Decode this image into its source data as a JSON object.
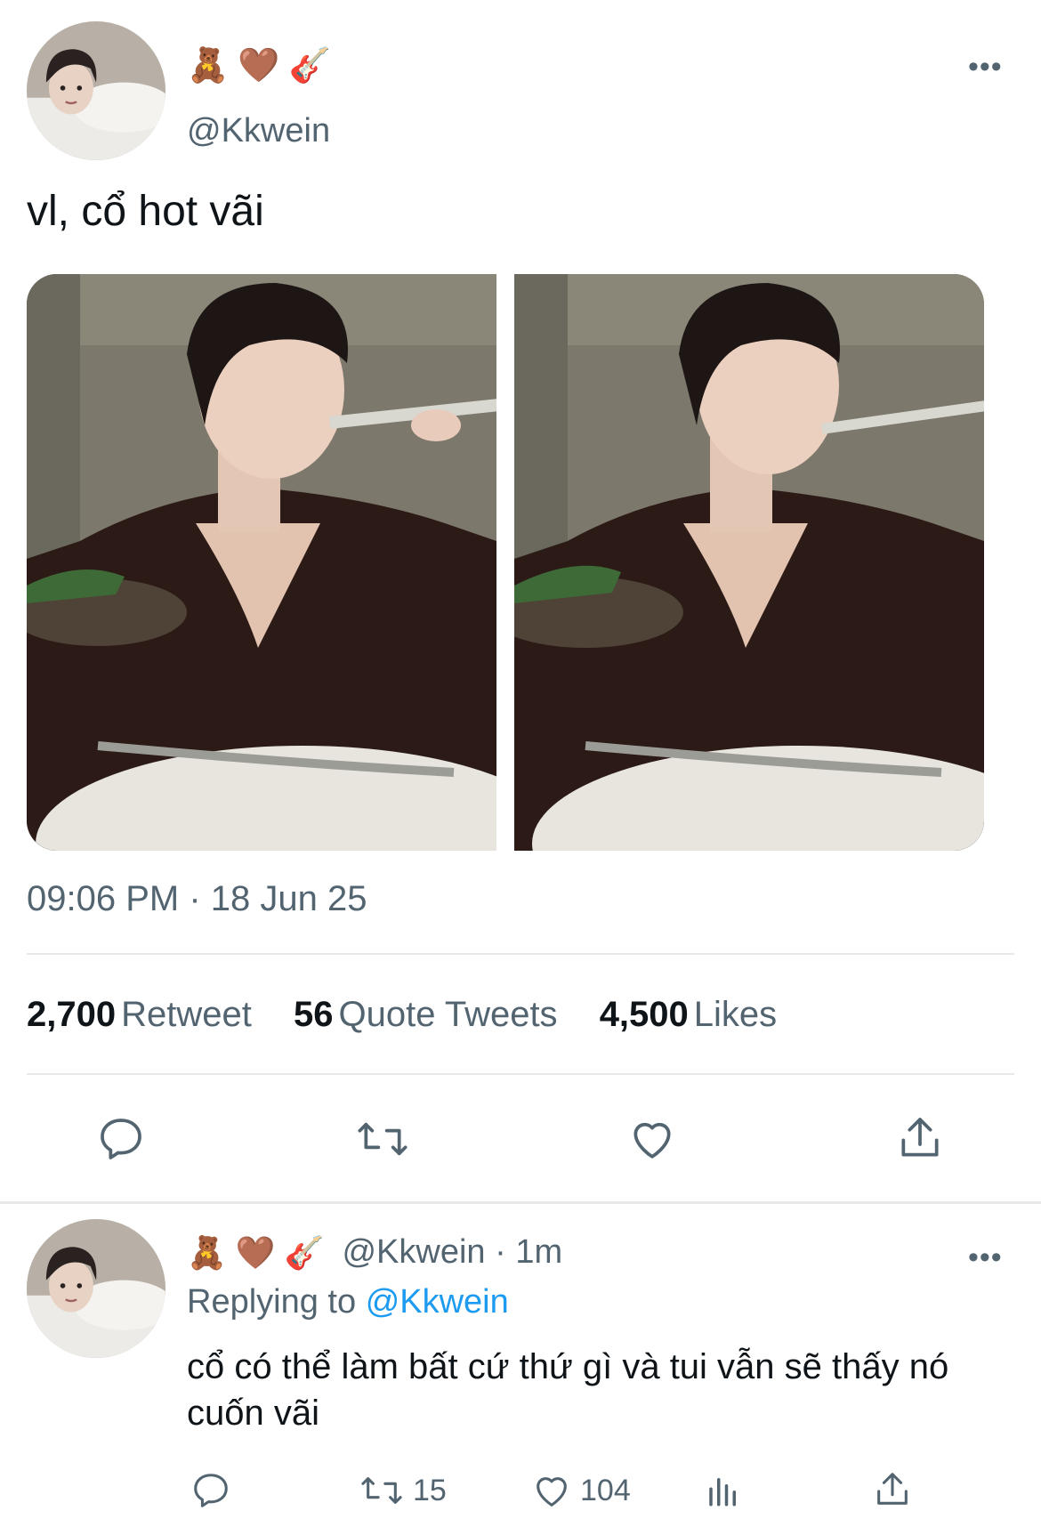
{
  "tweet": {
    "author_emojis": [
      "🧸",
      "🤎",
      "🎸"
    ],
    "handle": "@Kkwein",
    "more_icon": "•••",
    "text": "vl, cổ hot vãi",
    "timestamp": "09:06 PM · 18 Jun 25",
    "stats": {
      "retweets_count": "2,700",
      "retweets_label": "Retweet",
      "quotes_count": "56",
      "quotes_label": "Quote Tweets",
      "likes_count": "4,500",
      "likes_label": "Likes"
    },
    "actions": [
      "reply-icon",
      "retweet-icon",
      "heart-icon",
      "share-icon"
    ]
  },
  "reply": {
    "author_emojis": [
      "🧸",
      "🤎",
      "🎸"
    ],
    "handle_time": "@Kkwein · 1m",
    "more_icon": "•••",
    "replying_prefix": "Replying to",
    "replying_handle": "@Kkwein",
    "text": "cổ có thể làm bất cứ thứ gì và tui vẫn sẽ thấy nó cuốn vãi",
    "retweet_count": "15",
    "like_count": "104",
    "actions": [
      "reply-icon",
      "retweet-icon",
      "heart-icon",
      "analytics-icon",
      "share-icon"
    ]
  },
  "colors": {
    "text_primary": "#0f1419",
    "text_secondary": "#536471",
    "link": "#1d9bf0",
    "divider": "#e6e8ea"
  }
}
